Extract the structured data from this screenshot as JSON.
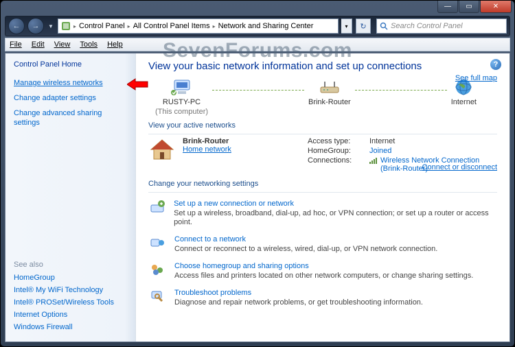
{
  "watermark": "SevenForums.com",
  "titlebar": {
    "min": "—",
    "max": "▭",
    "close": "✕"
  },
  "nav": {
    "back": "←",
    "fwd": "→"
  },
  "breadcrumb": {
    "root": "Control Panel",
    "mid": "All Control Panel Items",
    "leaf": "Network and Sharing Center"
  },
  "search": {
    "placeholder": "Search Control Panel"
  },
  "menu": {
    "file": "File",
    "edit": "Edit",
    "view": "View",
    "tools": "Tools",
    "help": "Help"
  },
  "sidebar": {
    "home": "Control Panel Home",
    "links": {
      "mwn": "Manage wireless networks",
      "cas": "Change adapter settings",
      "cass": "Change advanced sharing settings"
    },
    "seealso_title": "See also",
    "seealso": {
      "hg": "HomeGroup",
      "imw": "Intel® My WiFi Technology",
      "ipw": "Intel® PROSet/Wireless Tools",
      "io": "Internet Options",
      "wf": "Windows Firewall"
    }
  },
  "main": {
    "title": "View your basic network information and set up connections",
    "fullmap": "See full map",
    "node1": "RUSTY-PC",
    "node1_sub": "(This computer)",
    "node2": "Brink-Router",
    "node3": "Internet",
    "active_header": "View your active networks",
    "disconnect": "Connect or disconnect",
    "active_name": "Brink-Router",
    "active_type": "Home network",
    "acc_label": "Access type:",
    "acc_val": "Internet",
    "hg_label": "HomeGroup:",
    "hg_val": "Joined",
    "conn_label": "Connections:",
    "conn_val": "Wireless Network Connection (Brink-Router)",
    "settings_header": "Change your networking settings",
    "tasks": {
      "t1": {
        "title": "Set up a new connection or network",
        "desc": "Set up a wireless, broadband, dial-up, ad hoc, or VPN connection; or set up a router or access point."
      },
      "t2": {
        "title": "Connect to a network",
        "desc": "Connect or reconnect to a wireless, wired, dial-up, or VPN network connection."
      },
      "t3": {
        "title": "Choose homegroup and sharing options",
        "desc": "Access files and printers located on other network computers, or change sharing settings."
      },
      "t4": {
        "title": "Troubleshoot problems",
        "desc": "Diagnose and repair network problems, or get troubleshooting information."
      }
    }
  }
}
